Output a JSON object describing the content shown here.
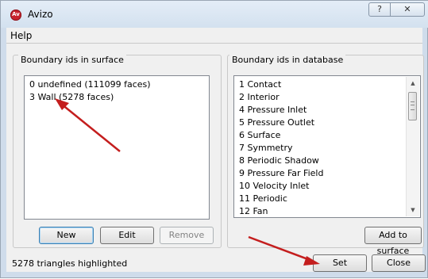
{
  "window": {
    "title": "Avizo",
    "app_icon_text": "Av"
  },
  "titlebar": {
    "help_glyph": "?",
    "close_glyph": "✕"
  },
  "menu": {
    "help_label": "Help"
  },
  "surface_group": {
    "title": "Boundary ids in surface",
    "items": [
      "0  undefined (111099 faces)",
      "3  Wall (5278 faces)"
    ],
    "buttons": {
      "new": "New",
      "edit": "Edit",
      "remove": "Remove"
    }
  },
  "database_group": {
    "title": "Boundary ids in database",
    "items": [
      "1  Contact",
      "2  Interior",
      "4  Pressure Inlet",
      "5  Pressure Outlet",
      "6  Surface",
      "7  Symmetry",
      "8  Periodic Shadow",
      "9  Pressure Far Field",
      "10  Velocity Inlet",
      "11  Periodic",
      "12  Fan"
    ],
    "add_button": "Add to surface",
    "scroll_up": "▲",
    "scroll_down": "▼"
  },
  "footer": {
    "status": "5278 triangles highlighted",
    "set_button": "Set",
    "close_button": "Close"
  },
  "annotation_color": "#c41e1e"
}
